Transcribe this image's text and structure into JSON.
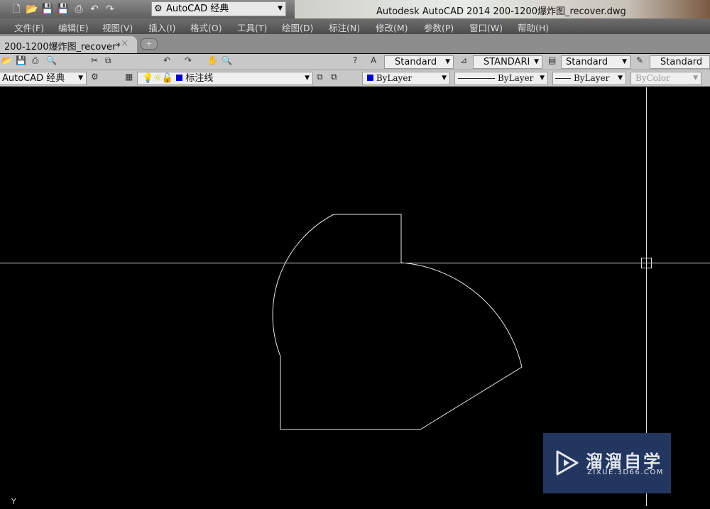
{
  "window": {
    "title": "Autodesk AutoCAD 2014    200-1200爆炸图_recover.dwg",
    "workspace": "AutoCAD 经典"
  },
  "menu": [
    "文件(F)",
    "编辑(E)",
    "视图(V)",
    "插入(I)",
    "格式(O)",
    "工具(T)",
    "绘图(D)",
    "标注(N)",
    "修改(M)",
    "参数(P)",
    "窗口(W)",
    "帮助(H)"
  ],
  "tabs": {
    "active": "200-1200爆炸图_recover*",
    "close": "×",
    "new": "+"
  },
  "styles": {
    "text_style": "Standard",
    "dim_style": "STANDARI",
    "table_style": "Standard",
    "multileader_style": "Standard"
  },
  "layers": {
    "workspace": "AutoCAD 经典",
    "current_layer": "标注线",
    "layer_color": "#0000cc"
  },
  "properties": {
    "color": "ByLayer",
    "linetype": "ByLayer",
    "lineweight": "ByLayer",
    "plotstyle": "ByColor"
  },
  "watermark": {
    "name": "溜溜自学",
    "url": "ZIXUE.3D66.COM"
  },
  "ucs": "Y"
}
